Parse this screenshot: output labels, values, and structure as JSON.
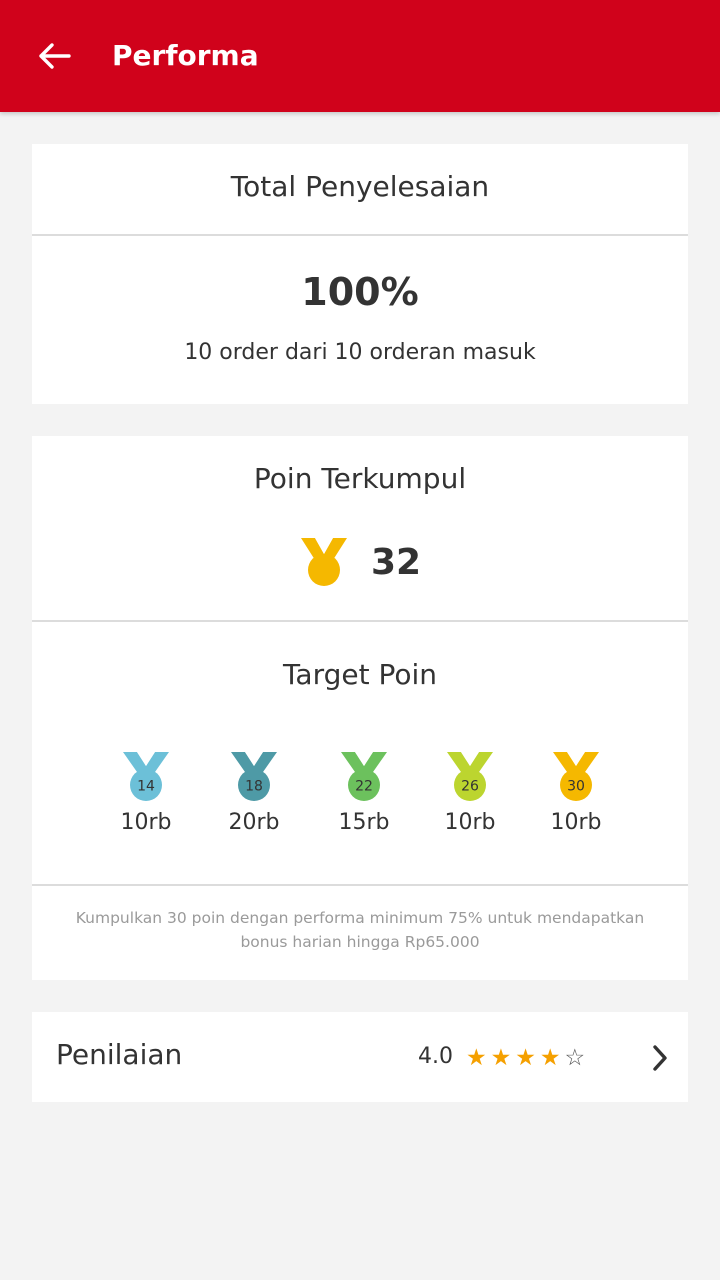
{
  "appbar": {
    "title": "Performa",
    "bg_color": "#d0021b"
  },
  "completion": {
    "title": "Total Penyelesaian",
    "percent": "100%",
    "detail": "10 order dari 10 orderan masuk"
  },
  "points": {
    "title": "Poin Terkumpul",
    "value": "32",
    "medal_color": "#f5b800"
  },
  "target": {
    "title": "Target Poin",
    "medals": [
      {
        "points": "14",
        "amount": "10rb",
        "color": "#6cc0d8"
      },
      {
        "points": "18",
        "amount": "20rb",
        "color": "#4e9aa6"
      },
      {
        "points": "22",
        "amount": "15rb",
        "color": "#6cc15d"
      },
      {
        "points": "26",
        "amount": "10rb",
        "color": "#bcd52f"
      },
      {
        "points": "30",
        "amount": "10rb",
        "color": "#f5b800"
      }
    ],
    "note": "Kumpulkan 30 poin dengan performa minimum 75% untuk mendapatkan bonus harian hingga Rp65.000"
  },
  "rating": {
    "label": "Penilaian",
    "value": "4.0",
    "stars_filled": 4,
    "stars_total": 5,
    "star_color": "#f5a000"
  }
}
